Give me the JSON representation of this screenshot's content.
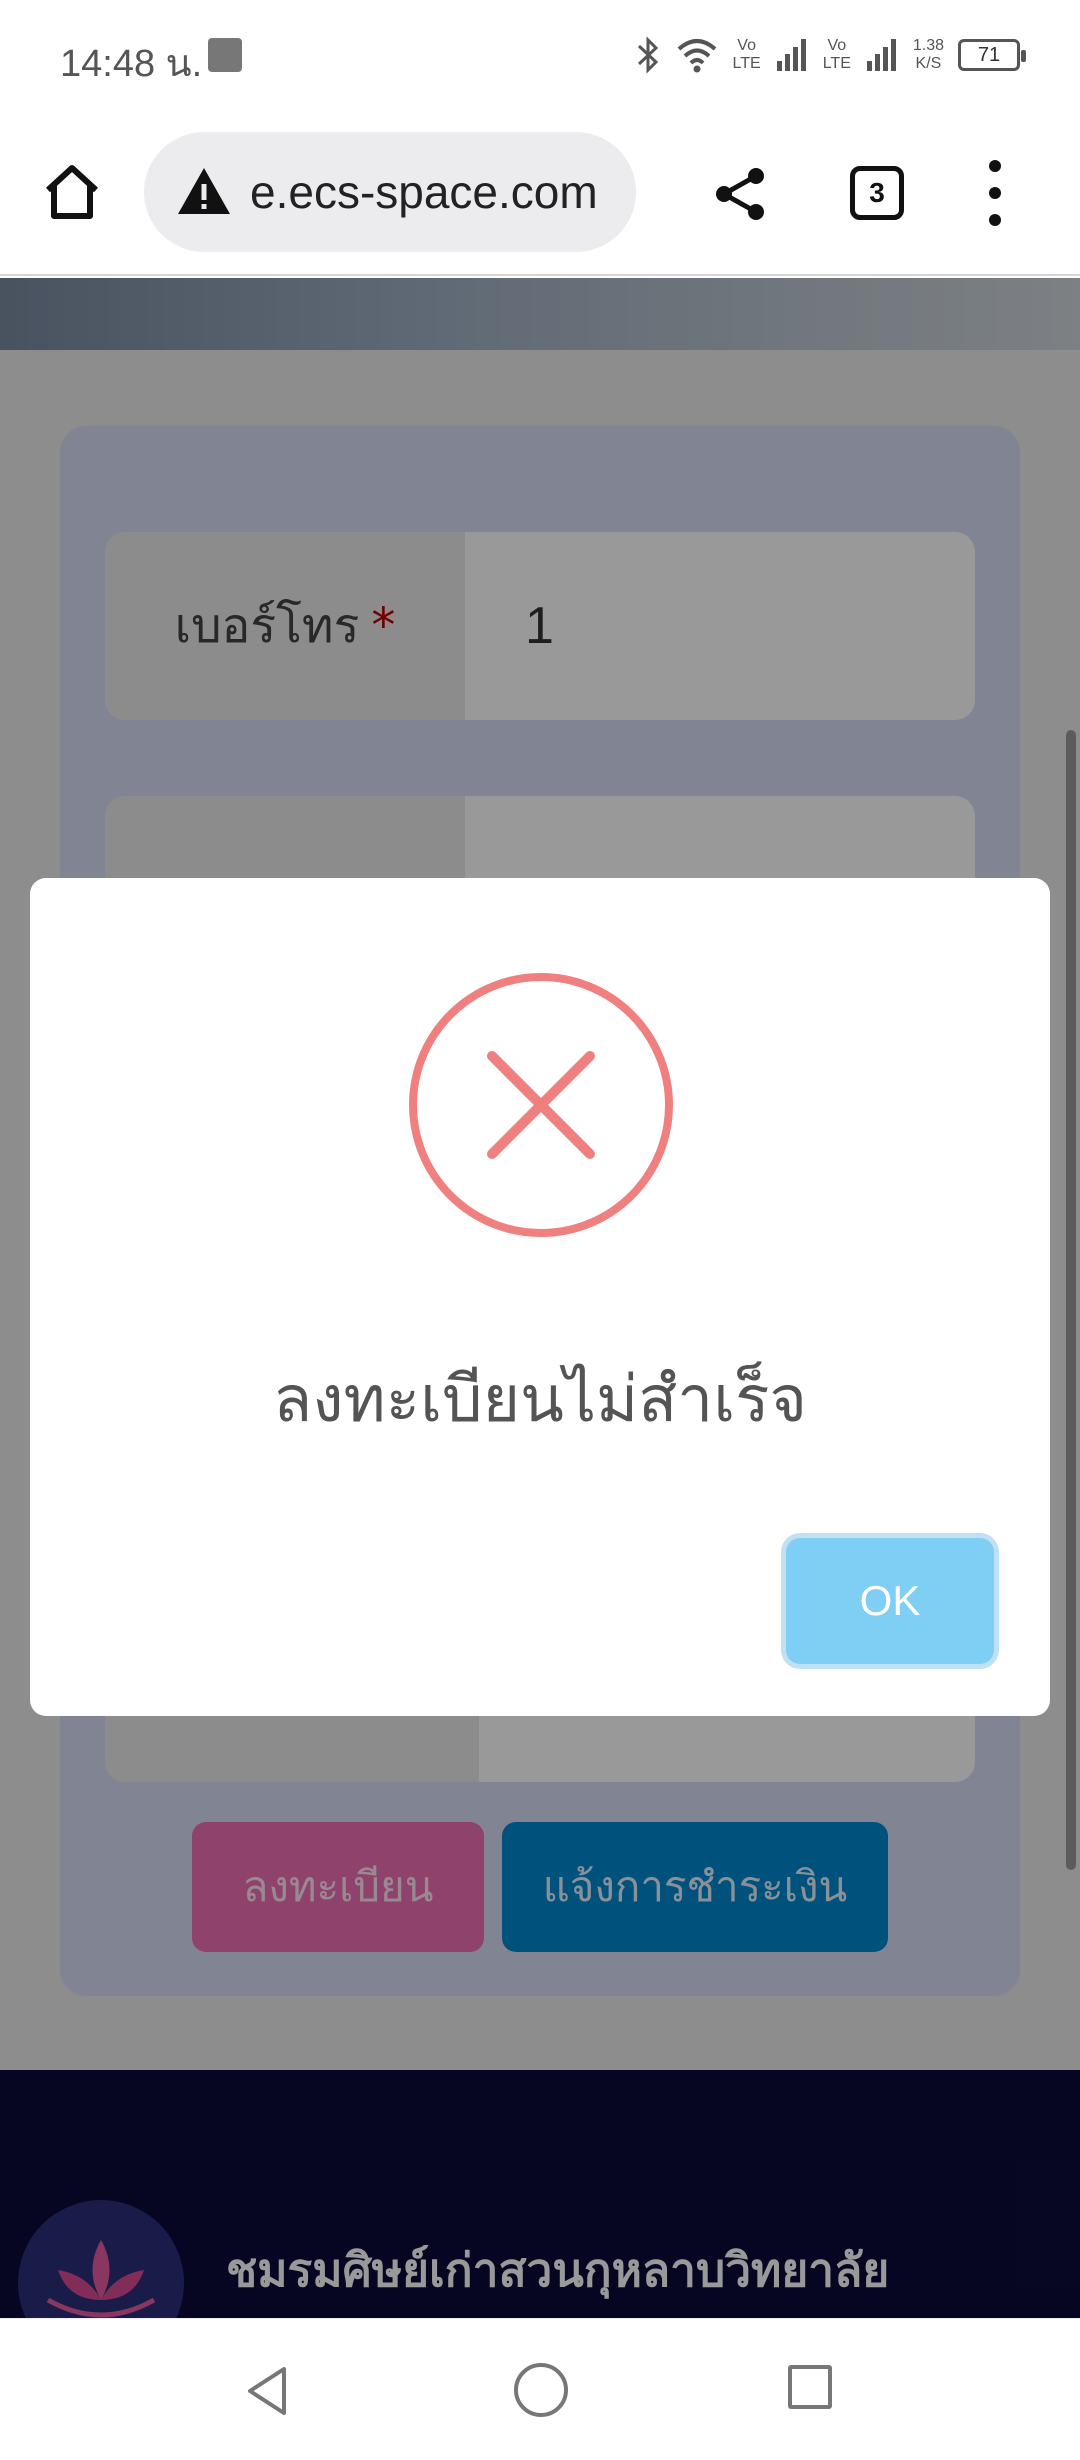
{
  "status_bar": {
    "time": "14:48 น.",
    "network_1": "Vo\nLTE",
    "network_2": "Vo\nLTE",
    "speed": "1.38\nK/S",
    "battery": "71"
  },
  "browser": {
    "url": "e.ecs-space.com",
    "tab_count": "3",
    "icons": [
      "home-icon",
      "warning-icon",
      "share-icon",
      "more-vert-icon"
    ]
  },
  "form": {
    "phone_label": "เบอร์โทร",
    "required_mark": "*",
    "phone_value": "1",
    "register_button": "ลงทะเบียน",
    "payment_button": "แจ้งการชำระเงิน"
  },
  "footer": {
    "title": "ชมรมศิษย์เก่าสวนกุหลาบวิทยาลัย"
  },
  "dialog": {
    "icon": "error-x-icon",
    "message": "ลงทะเบียนไม่สำเร็จ",
    "ok_label": "OK",
    "colors": {
      "icon": "#f08080",
      "ok_button": "#7fcff5"
    }
  },
  "nav_bar": {
    "icons": [
      "back-icon",
      "home-circle-icon",
      "recents-icon"
    ]
  }
}
